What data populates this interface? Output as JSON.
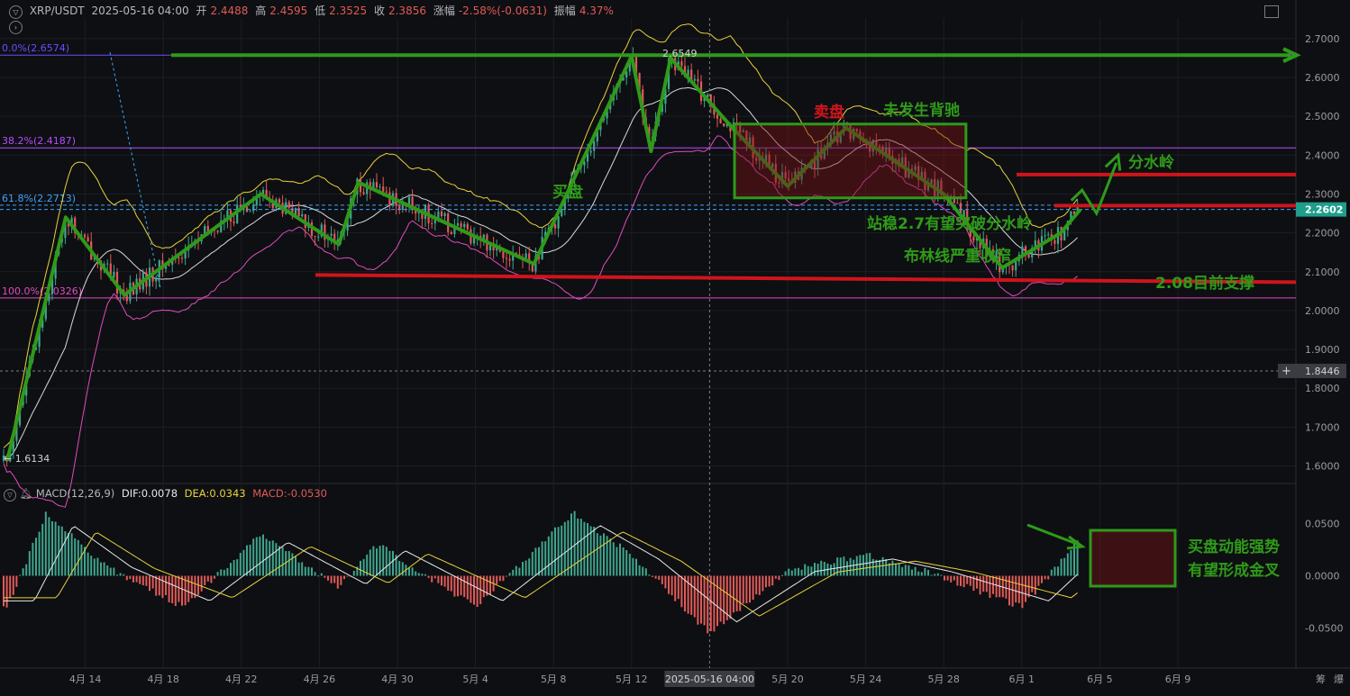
{
  "header": {
    "symbol": "XRP/USDT",
    "datetime": "2025-05-16 04:00",
    "open_label": "开",
    "open": "2.4488",
    "high_label": "高",
    "high": "2.4595",
    "low_label": "低",
    "low": "2.3525",
    "close_label": "收",
    "close": "2.3856",
    "change_label": "涨幅",
    "change": "-2.58%(-0.0631)",
    "amp_label": "振幅",
    "amp": "4.37%"
  },
  "macd_header": {
    "name": "MACD(12,26,9)",
    "dif_label": "DIF:",
    "dif": "0.0078",
    "dea_label": "DEA:",
    "dea": "0.0343",
    "macd_label": "MACD:",
    "macd": "-0.0530"
  },
  "price_axis": {
    "ticks": [
      "2.7000",
      "2.6000",
      "2.5000",
      "2.4000",
      "2.3000",
      "2.2000",
      "2.1000",
      "2.0000",
      "1.9000",
      "1.8000",
      "1.7000",
      "1.6000"
    ],
    "current_price": "2.2602",
    "cursor_price": "1.8446",
    "current_color": "#1f9e8c"
  },
  "macd_axis": {
    "ticks": [
      "0.0500",
      "0.0000",
      "-0.0500"
    ]
  },
  "time_axis": {
    "ticks": [
      "4月 14",
      "4月 18",
      "4月 22",
      "4月 26",
      "4月 30",
      "5月 4",
      "5月 8",
      "5月 12",
      "5月 20",
      "5月 24",
      "5月 28",
      "6月 1",
      "6月 5",
      "6月 9"
    ],
    "cursor_label": "2025-05-16 04:00",
    "corner_labels": [
      "筹",
      "爆"
    ]
  },
  "fib_levels": [
    {
      "label": "0.0%(2.6574)",
      "value": 2.6574,
      "color": "#6b4cff"
    },
    {
      "label": "38.2%(2.4187)",
      "value": 2.4187,
      "color": "#b64dff"
    },
    {
      "label": "61.8%(2.2713)",
      "value": 2.2713,
      "color": "#3fa3ff"
    },
    {
      "label": "100.0%(2.0326)",
      "value": 2.0326,
      "color": "#e04cc0"
    }
  ],
  "price_labels": {
    "high": "2.6549",
    "low": "1.6134"
  },
  "annotations": {
    "buy_side": "买盘",
    "sell_side": "卖盘",
    "no_divergence": "未发生背驰",
    "watershed": "分水岭",
    "hold_27": "站稳2.7有望突破分水岭",
    "bollinger_narrow": "布林线严重收窄",
    "support_208": "2.08目前支撑",
    "macd_strong_line1": "买盘动能强势",
    "macd_strong_line2": "有望形成金叉"
  },
  "colors": {
    "up": "#3fa58e",
    "down": "#e05a58",
    "annotation_green": "#2f9a1a",
    "annotation_red": "#d0141c",
    "dif": "#e8e8e8",
    "dea": "#e8d23a",
    "boll_upper": "#e8d23a",
    "boll_mid": "#d9d9d9",
    "boll_lower": "#e04cc0"
  },
  "chart_data": [
    {
      "type": "candlestick",
      "pair": "XRP/USDT",
      "y_range": [
        1.56,
        2.74
      ],
      "x_dates": [
        "04-10",
        "04-14",
        "04-18",
        "04-22",
        "04-26",
        "04-30",
        "05-04",
        "05-08",
        "05-12",
        "05-16",
        "05-20",
        "05-24",
        "05-28",
        "06-01",
        "06-05",
        "06-09"
      ],
      "price_path": [
        {
          "date": "04-10",
          "price": 1.6134
        },
        {
          "date": "04-13",
          "price": 2.24
        },
        {
          "date": "04-16",
          "price": 2.04
        },
        {
          "date": "04-23",
          "price": 2.3
        },
        {
          "date": "04-27",
          "price": 2.17
        },
        {
          "date": "04-28",
          "price": 2.33
        },
        {
          "date": "05-07",
          "price": 2.12
        },
        {
          "date": "05-12",
          "price": 2.6549
        },
        {
          "date": "05-13",
          "price": 2.41
        },
        {
          "date": "05-14",
          "price": 2.65
        },
        {
          "date": "05-17",
          "price": 2.48
        },
        {
          "date": "05-20",
          "price": 2.32
        },
        {
          "date": "05-23",
          "price": 2.47
        },
        {
          "date": "05-28",
          "price": 2.3
        },
        {
          "date": "05-31",
          "price": 2.11
        },
        {
          "date": "06-03",
          "price": 2.2
        },
        {
          "date": "06-04",
          "price": 2.2602
        }
      ],
      "horizontal_levels": {
        "resistance_top": 2.6574,
        "watershed_1": 2.35,
        "watershed_2": 2.27,
        "support": 2.08
      },
      "overlays": [
        "Bollinger upper",
        "Bollinger middle",
        "Bollinger lower",
        "Fibonacci retracement"
      ]
    },
    {
      "type": "bar",
      "indicator": "MACD(12,26,9)",
      "y_range": [
        -0.09,
        0.075
      ],
      "series": [
        {
          "name": "DIF",
          "value": 0.0078
        },
        {
          "name": "DEA",
          "value": 0.0343
        },
        {
          "name": "MACD",
          "value": -0.053
        }
      ],
      "histogram_path": [
        {
          "date": "04-10",
          "value": -0.03
        },
        {
          "date": "04-12",
          "value": 0.06
        },
        {
          "date": "04-15",
          "value": 0.01
        },
        {
          "date": "04-19",
          "value": -0.03
        },
        {
          "date": "04-23",
          "value": 0.04
        },
        {
          "date": "04-27",
          "value": -0.01
        },
        {
          "date": "04-29",
          "value": 0.03
        },
        {
          "date": "05-04",
          "value": -0.03
        },
        {
          "date": "05-09",
          "value": 0.06
        },
        {
          "date": "05-12",
          "value": 0.02
        },
        {
          "date": "05-16",
          "value": -0.055
        },
        {
          "date": "05-20",
          "value": 0.005
        },
        {
          "date": "05-24",
          "value": 0.02
        },
        {
          "date": "05-27",
          "value": 0.005
        },
        {
          "date": "06-01",
          "value": -0.03
        },
        {
          "date": "06-04",
          "value": 0.035
        }
      ]
    }
  ]
}
